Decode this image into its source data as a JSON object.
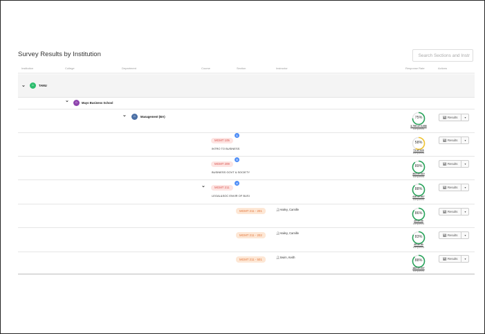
{
  "page": {
    "title": "Survey Results by Institution"
  },
  "search": {
    "placeholder": "Search Sections and Instr"
  },
  "columns": {
    "institution": "Institution",
    "college": "College",
    "department": "Department",
    "course": "Course",
    "section": "Section",
    "instructor": "Instructor",
    "response_rate": "Response Rate",
    "actions": "Actions"
  },
  "institution": {
    "name": "TAMU",
    "icon": "institution-icon",
    "color": "#2dbd6e"
  },
  "college": {
    "name": "Mays Business School",
    "icon": "institution-icon",
    "color": "#8e44ad"
  },
  "department": {
    "name": "Management (BA)",
    "icon": "institution-icon",
    "color": "#4a6fa5",
    "rate": "75%",
    "rate_value": 75,
    "ring_color": "#27a35a",
    "completed": "3,795 of 5,058",
    "completed_label": "completed"
  },
  "courses": [
    {
      "code": "MGMT 105",
      "name": "INTRO TO BUSINESS",
      "count": "1",
      "rate": "58%",
      "rate_value": 58,
      "ring_color": "#f0c330",
      "completed": "71 of 123",
      "completed_label": "completed",
      "chevron": "chevron-right-icon"
    },
    {
      "code": "MGMT 209",
      "name": "BUSINESS GOVT & SOCIETY",
      "count": "5",
      "rate": "89%",
      "rate_value": 89,
      "ring_color": "#27a35a",
      "completed": "363 of 410",
      "completed_label": "completed",
      "chevron": "chevron-right-icon"
    },
    {
      "code": "MGMT 211",
      "name": "LEGAL&SOC ENVIR OF BUSI",
      "count": "4",
      "rate": "88%",
      "rate_value": 88,
      "ring_color": "#27a35a",
      "completed": "410 of 467",
      "completed_label": "completed",
      "chevron": "chevron-down-icon"
    }
  ],
  "sections": [
    {
      "code": "MGMT 211 - 201",
      "instructor": "Hailey, Camille",
      "rate": "86%",
      "rate_value": 86,
      "ring_color": "#27a35a",
      "completed": "25 of 29",
      "completed_label": "completed"
    },
    {
      "code": "MGMT 211 - 202",
      "instructor": "Hailey, Camille",
      "rate": "83%",
      "rate_value": 83,
      "ring_color": "#27a35a",
      "completed": "25 of 30",
      "completed_label": "completed"
    },
    {
      "code": "MGMT 211 - 501",
      "instructor": "Swim, Keith",
      "rate": "88%",
      "rate_value": 88,
      "ring_color": "#27a35a",
      "completed": "183 of 207",
      "completed_label": "completed"
    }
  ],
  "actions": {
    "results_label": "Results",
    "results_icon": "bar-chart-icon",
    "dropdown_icon": "caret-down-icon",
    "user_icon": "user-icon"
  }
}
